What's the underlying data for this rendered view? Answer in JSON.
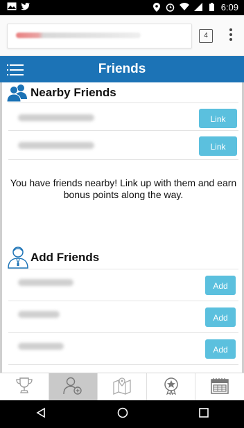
{
  "status_bar": {
    "time": "6:09",
    "left_icons": [
      "image-icon",
      "twitter-icon"
    ],
    "right_icons": [
      "location-icon",
      "alarm-icon",
      "wifi-icon",
      "signal-icon",
      "battery-icon"
    ]
  },
  "browser": {
    "tab_count": "4"
  },
  "app": {
    "title": "Friends",
    "accent_color": "#1c73b6",
    "button_color": "#5bc0de"
  },
  "nearby": {
    "heading": "Nearby Friends",
    "rows": [
      {
        "button_label": "Link"
      },
      {
        "button_label": "Link"
      }
    ],
    "message": "You have friends nearby! Link up with them and earn bonus points along the way."
  },
  "add": {
    "heading": "Add Friends",
    "rows": [
      {
        "button_label": "Add"
      },
      {
        "button_label": "Add"
      },
      {
        "button_label": "Add"
      }
    ]
  },
  "bottom_nav": {
    "items": [
      {
        "icon": "trophy-icon",
        "active": false
      },
      {
        "icon": "add-friend-icon",
        "active": true
      },
      {
        "icon": "map-icon",
        "active": false
      },
      {
        "icon": "badge-icon",
        "active": false
      },
      {
        "icon": "calendar-icon",
        "active": false
      }
    ]
  },
  "system_nav": [
    "back-icon",
    "home-icon",
    "recents-icon"
  ]
}
